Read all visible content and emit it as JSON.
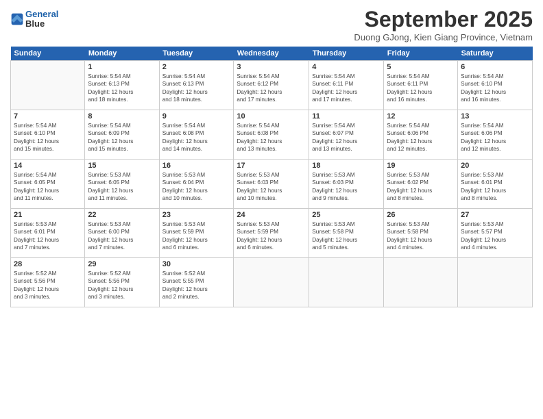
{
  "header": {
    "logo_line1": "General",
    "logo_line2": "Blue",
    "month_title": "September 2025",
    "subtitle": "Duong GJong, Kien Giang Province, Vietnam"
  },
  "days_of_week": [
    "Sunday",
    "Monday",
    "Tuesday",
    "Wednesday",
    "Thursday",
    "Friday",
    "Saturday"
  ],
  "weeks": [
    [
      {
        "day": "",
        "info": ""
      },
      {
        "day": "1",
        "info": "Sunrise: 5:54 AM\nSunset: 6:13 PM\nDaylight: 12 hours\nand 18 minutes."
      },
      {
        "day": "2",
        "info": "Sunrise: 5:54 AM\nSunset: 6:13 PM\nDaylight: 12 hours\nand 18 minutes."
      },
      {
        "day": "3",
        "info": "Sunrise: 5:54 AM\nSunset: 6:12 PM\nDaylight: 12 hours\nand 17 minutes."
      },
      {
        "day": "4",
        "info": "Sunrise: 5:54 AM\nSunset: 6:11 PM\nDaylight: 12 hours\nand 17 minutes."
      },
      {
        "day": "5",
        "info": "Sunrise: 5:54 AM\nSunset: 6:11 PM\nDaylight: 12 hours\nand 16 minutes."
      },
      {
        "day": "6",
        "info": "Sunrise: 5:54 AM\nSunset: 6:10 PM\nDaylight: 12 hours\nand 16 minutes."
      }
    ],
    [
      {
        "day": "7",
        "info": "Sunrise: 5:54 AM\nSunset: 6:10 PM\nDaylight: 12 hours\nand 15 minutes."
      },
      {
        "day": "8",
        "info": "Sunrise: 5:54 AM\nSunset: 6:09 PM\nDaylight: 12 hours\nand 15 minutes."
      },
      {
        "day": "9",
        "info": "Sunrise: 5:54 AM\nSunset: 6:08 PM\nDaylight: 12 hours\nand 14 minutes."
      },
      {
        "day": "10",
        "info": "Sunrise: 5:54 AM\nSunset: 6:08 PM\nDaylight: 12 hours\nand 13 minutes."
      },
      {
        "day": "11",
        "info": "Sunrise: 5:54 AM\nSunset: 6:07 PM\nDaylight: 12 hours\nand 13 minutes."
      },
      {
        "day": "12",
        "info": "Sunrise: 5:54 AM\nSunset: 6:06 PM\nDaylight: 12 hours\nand 12 minutes."
      },
      {
        "day": "13",
        "info": "Sunrise: 5:54 AM\nSunset: 6:06 PM\nDaylight: 12 hours\nand 12 minutes."
      }
    ],
    [
      {
        "day": "14",
        "info": "Sunrise: 5:54 AM\nSunset: 6:05 PM\nDaylight: 12 hours\nand 11 minutes."
      },
      {
        "day": "15",
        "info": "Sunrise: 5:53 AM\nSunset: 6:05 PM\nDaylight: 12 hours\nand 11 minutes."
      },
      {
        "day": "16",
        "info": "Sunrise: 5:53 AM\nSunset: 6:04 PM\nDaylight: 12 hours\nand 10 minutes."
      },
      {
        "day": "17",
        "info": "Sunrise: 5:53 AM\nSunset: 6:03 PM\nDaylight: 12 hours\nand 10 minutes."
      },
      {
        "day": "18",
        "info": "Sunrise: 5:53 AM\nSunset: 6:03 PM\nDaylight: 12 hours\nand 9 minutes."
      },
      {
        "day": "19",
        "info": "Sunrise: 5:53 AM\nSunset: 6:02 PM\nDaylight: 12 hours\nand 8 minutes."
      },
      {
        "day": "20",
        "info": "Sunrise: 5:53 AM\nSunset: 6:01 PM\nDaylight: 12 hours\nand 8 minutes."
      }
    ],
    [
      {
        "day": "21",
        "info": "Sunrise: 5:53 AM\nSunset: 6:01 PM\nDaylight: 12 hours\nand 7 minutes."
      },
      {
        "day": "22",
        "info": "Sunrise: 5:53 AM\nSunset: 6:00 PM\nDaylight: 12 hours\nand 7 minutes."
      },
      {
        "day": "23",
        "info": "Sunrise: 5:53 AM\nSunset: 5:59 PM\nDaylight: 12 hours\nand 6 minutes."
      },
      {
        "day": "24",
        "info": "Sunrise: 5:53 AM\nSunset: 5:59 PM\nDaylight: 12 hours\nand 6 minutes."
      },
      {
        "day": "25",
        "info": "Sunrise: 5:53 AM\nSunset: 5:58 PM\nDaylight: 12 hours\nand 5 minutes."
      },
      {
        "day": "26",
        "info": "Sunrise: 5:53 AM\nSunset: 5:58 PM\nDaylight: 12 hours\nand 4 minutes."
      },
      {
        "day": "27",
        "info": "Sunrise: 5:53 AM\nSunset: 5:57 PM\nDaylight: 12 hours\nand 4 minutes."
      }
    ],
    [
      {
        "day": "28",
        "info": "Sunrise: 5:52 AM\nSunset: 5:56 PM\nDaylight: 12 hours\nand 3 minutes."
      },
      {
        "day": "29",
        "info": "Sunrise: 5:52 AM\nSunset: 5:56 PM\nDaylight: 12 hours\nand 3 minutes."
      },
      {
        "day": "30",
        "info": "Sunrise: 5:52 AM\nSunset: 5:55 PM\nDaylight: 12 hours\nand 2 minutes."
      },
      {
        "day": "",
        "info": ""
      },
      {
        "day": "",
        "info": ""
      },
      {
        "day": "",
        "info": ""
      },
      {
        "day": "",
        "info": ""
      }
    ]
  ]
}
